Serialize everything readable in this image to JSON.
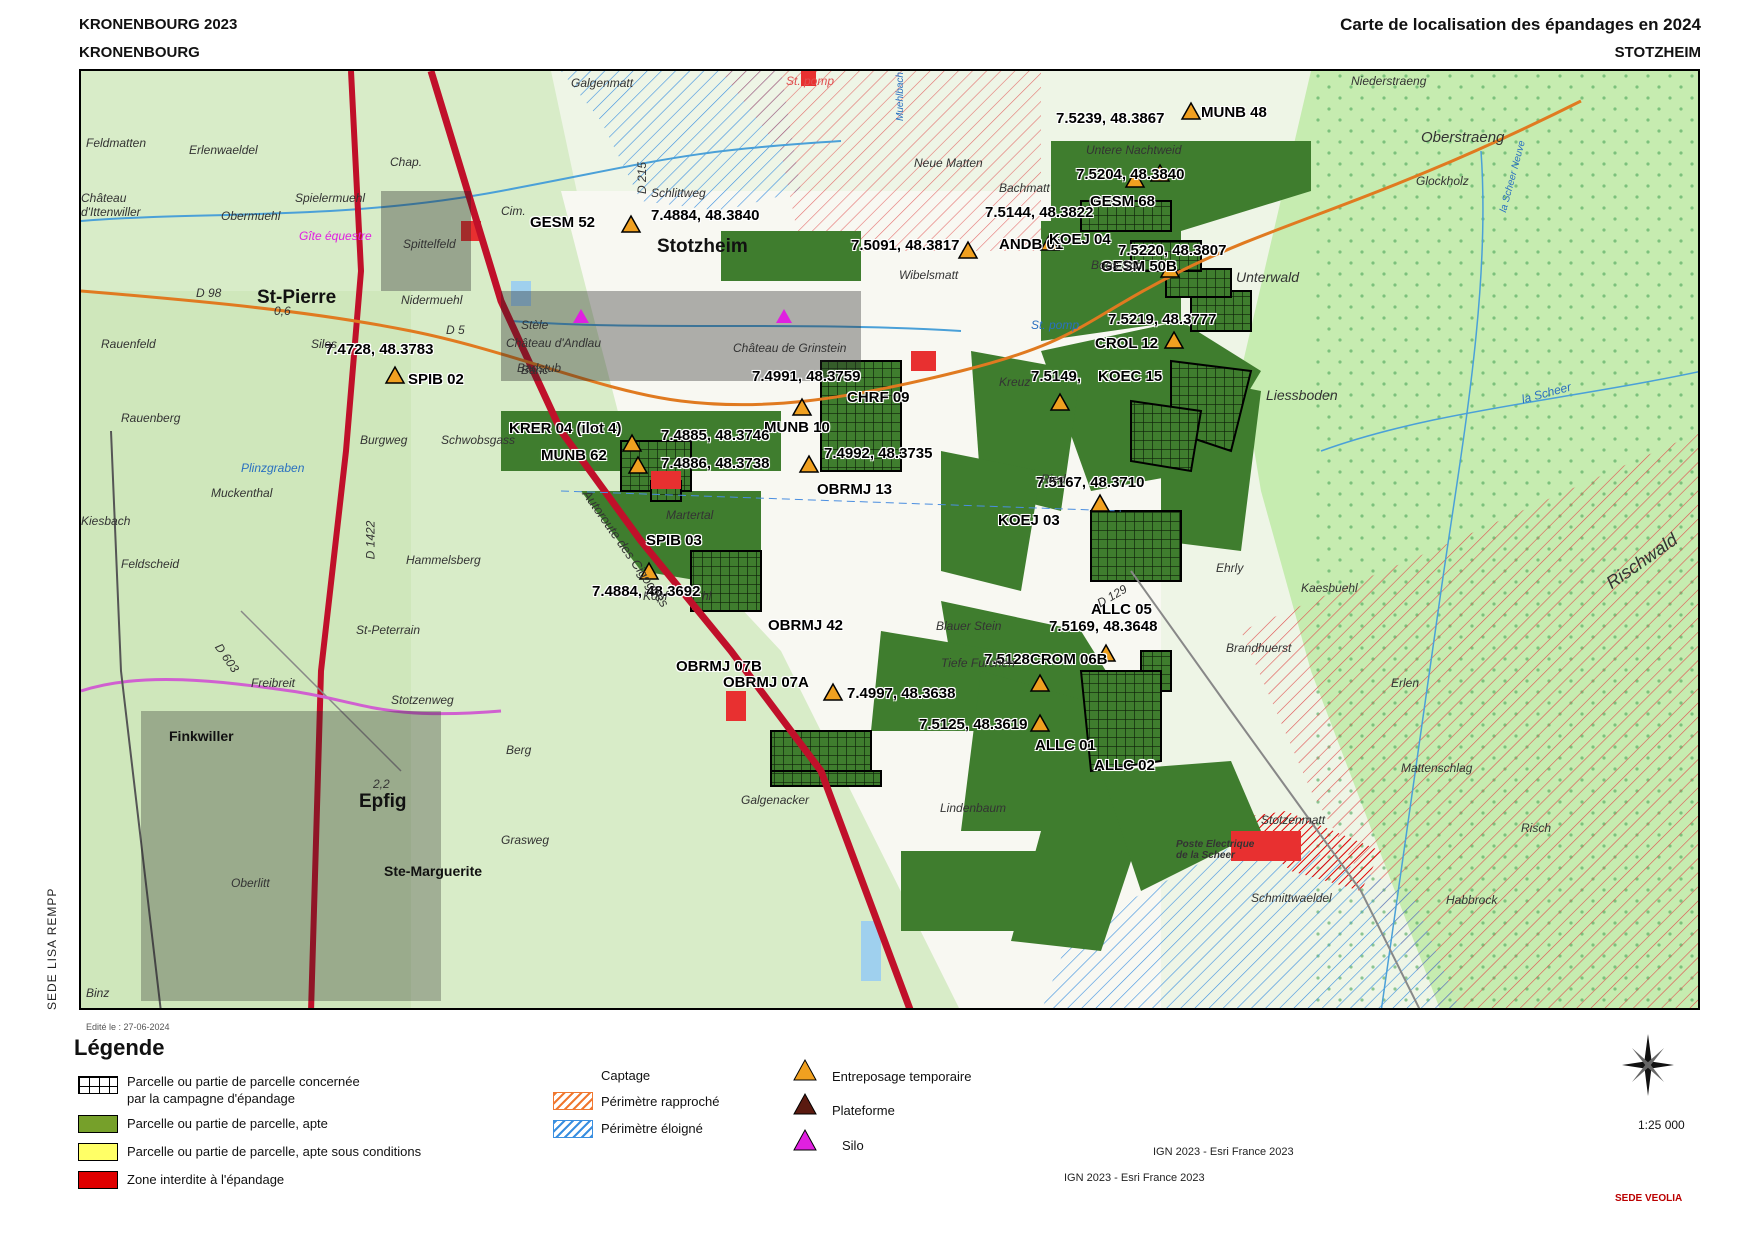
{
  "header": {
    "left_line1": "KRONENBOURG 2023",
    "left_line2": "KRONENBOURG",
    "right_line1": "Carte de localisation des épandages en 2024",
    "right_line2": "STOTZHEIM"
  },
  "side_text": "SEDE  LISA REMPP",
  "edit_date": "Edité le : 27-06-2024",
  "map": {
    "parcel_labels": [
      "MUNB 48",
      "GESM 52",
      "GESM 68",
      "ANDB 01",
      "KOEJ 04",
      "GESM 50B",
      "CROL 12",
      "KOEC 15",
      "SPIB 02",
      "CHRF 09",
      "KRER 04 (ilot 4)",
      "MUNB 10",
      "MUNB 62",
      "OBRMJ 13",
      "KOEJ 03",
      "SPIB 03",
      "ALLC 05",
      "OBRMJ 42",
      "CROM 06B",
      "OBRMJ 07B",
      "OBRMJ 07A",
      "ALLC 01",
      "ALLC 02"
    ],
    "coord_labels": [
      "7.5239, 48.3867",
      "7.5204, 48.3840",
      "7.5144, 48.3822",
      "7.4884, 48.3840",
      "7.5091, 48.3817",
      "7.5220, 48.3807",
      "7.5219, 48.3777",
      "7.4728, 48.3783",
      "7.4991, 48.3759",
      "7.5149,",
      "7.4885, 48.3746",
      "7.4992, 48.3735",
      "7.4886, 48.3738",
      "7.5167, 48.3710",
      "7.4884, 48.3692",
      "7.5169, 48.3648",
      "7.5128",
      "7.4997, 48.3638",
      "7.5125, 48.3619"
    ],
    "towns": [
      "Stotzheim",
      "St-Pierre",
      "Epfig",
      "Finkwiller",
      "Ste-Marguerite"
    ],
    "places": [
      "Galgenmatt",
      "Feldmatten",
      "Erlenwaeldel",
      "Obermuehl",
      "Château d'Ittenwiller",
      "Spielermuehl",
      "Gîte équestre",
      "Spittelfeld",
      "Nidermuehl",
      "Rauenfeld",
      "Rauenberg",
      "Burgweg",
      "Schwobsgass",
      "Muckenthal",
      "Kiesbach",
      "Feldscheid",
      "Hammelsberg",
      "St-Peterrain",
      "Freibreit",
      "Stotzenweg",
      "Berg",
      "Grasweg",
      "Oberlitt",
      "Binz",
      "Martertal",
      "Galgenacker",
      "Lindenbaum",
      "Tiefe Furchen",
      "Blauer Stein",
      "Neue Matten",
      "Bachmatt",
      "Untere Nachtweid",
      "Wibelsmatt",
      "Boes Sch",
      "Château d'Andlau",
      "Château de Grinstein",
      "Badstub",
      "Stèle",
      "Silos",
      "Banc",
      "Chap.",
      "Cim.",
      "Schlittweg",
      "Niederstraeng",
      "Oberstraeng",
      "Glockholz",
      "Unterwald",
      "Liessboden",
      "Ehrly",
      "Kaesbuehl",
      "Rischwald",
      "Brandhuerst",
      "Erlen",
      "Mattenschlag",
      "Risch",
      "Stotzenmatt",
      "Schmittwaeldel",
      "Poste Electrique de la Scheer",
      "Habbrock",
      "Kreuz",
      "Ried",
      "St. pomp",
      "St. pomp",
      "Muehlbach",
      "la Scheer",
      "la Scheer Neuve",
      "Autoroute des Cigognes",
      "Plinzgraben",
      "D 98",
      "D 5",
      "D 1422",
      "D 603",
      "D 215",
      "D 129",
      "0,6",
      "2,2",
      "Kopf",
      "hl"
    ]
  },
  "legend": {
    "title": "Légende",
    "col1": [
      {
        "label": "Parcelle ou partie de parcelle concernée",
        "label2": "par la campagne d'épandage",
        "swatch": "grid"
      },
      {
        "label": "Parcelle ou partie de parcelle, apte",
        "swatch": "#76a02a"
      },
      {
        "label": "Parcelle ou partie de parcelle, apte sous conditions",
        "swatch": "#ffff66"
      },
      {
        "label": "Zone interdite à l'épandage",
        "swatch": "#e00000"
      }
    ],
    "captage_title": "Captage",
    "captage": [
      {
        "label": "Périmètre rapproché",
        "color": "#f07830"
      },
      {
        "label": "Périmètre éloigné",
        "color": "#3a8fe0"
      }
    ],
    "symbols": [
      {
        "label": "Entreposage temporaire",
        "color": "#f0a020",
        "icon": "triangle-icon"
      },
      {
        "label": "Plateforme",
        "color": "#5a1a10",
        "icon": "triangle-icon"
      },
      {
        "label": "Silo",
        "color": "#e020e0",
        "icon": "triangle-icon"
      }
    ]
  },
  "credits": [
    "IGN 2023 - Esri France 2023",
    "IGN 2023 - Esri France 2023"
  ],
  "scale": "1:25 000",
  "logo": "SEDE VEOLIA"
}
